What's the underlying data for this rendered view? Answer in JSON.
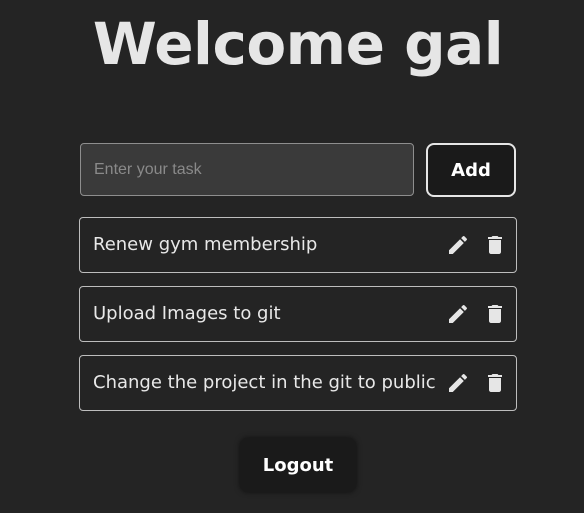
{
  "header": {
    "title": "Welcome gal"
  },
  "task_form": {
    "input_value": "",
    "input_placeholder": "Enter your task",
    "add_label": "Add"
  },
  "tasks": [
    {
      "text": "Renew gym membership",
      "edit_icon": "pencil-icon",
      "delete_icon": "trash-icon"
    },
    {
      "text": "Upload Images to git",
      "edit_icon": "pencil-icon",
      "delete_icon": "trash-icon"
    },
    {
      "text": "Change the project in the git to public",
      "edit_icon": "pencil-icon",
      "delete_icon": "trash-icon"
    }
  ],
  "footer": {
    "logout_label": "Logout"
  },
  "colors": {
    "background": "#242424",
    "text": "#e4e4e4",
    "button_bg": "#1a1a1a",
    "input_bg": "#3a3a3a",
    "border": "#bdbdbd"
  }
}
